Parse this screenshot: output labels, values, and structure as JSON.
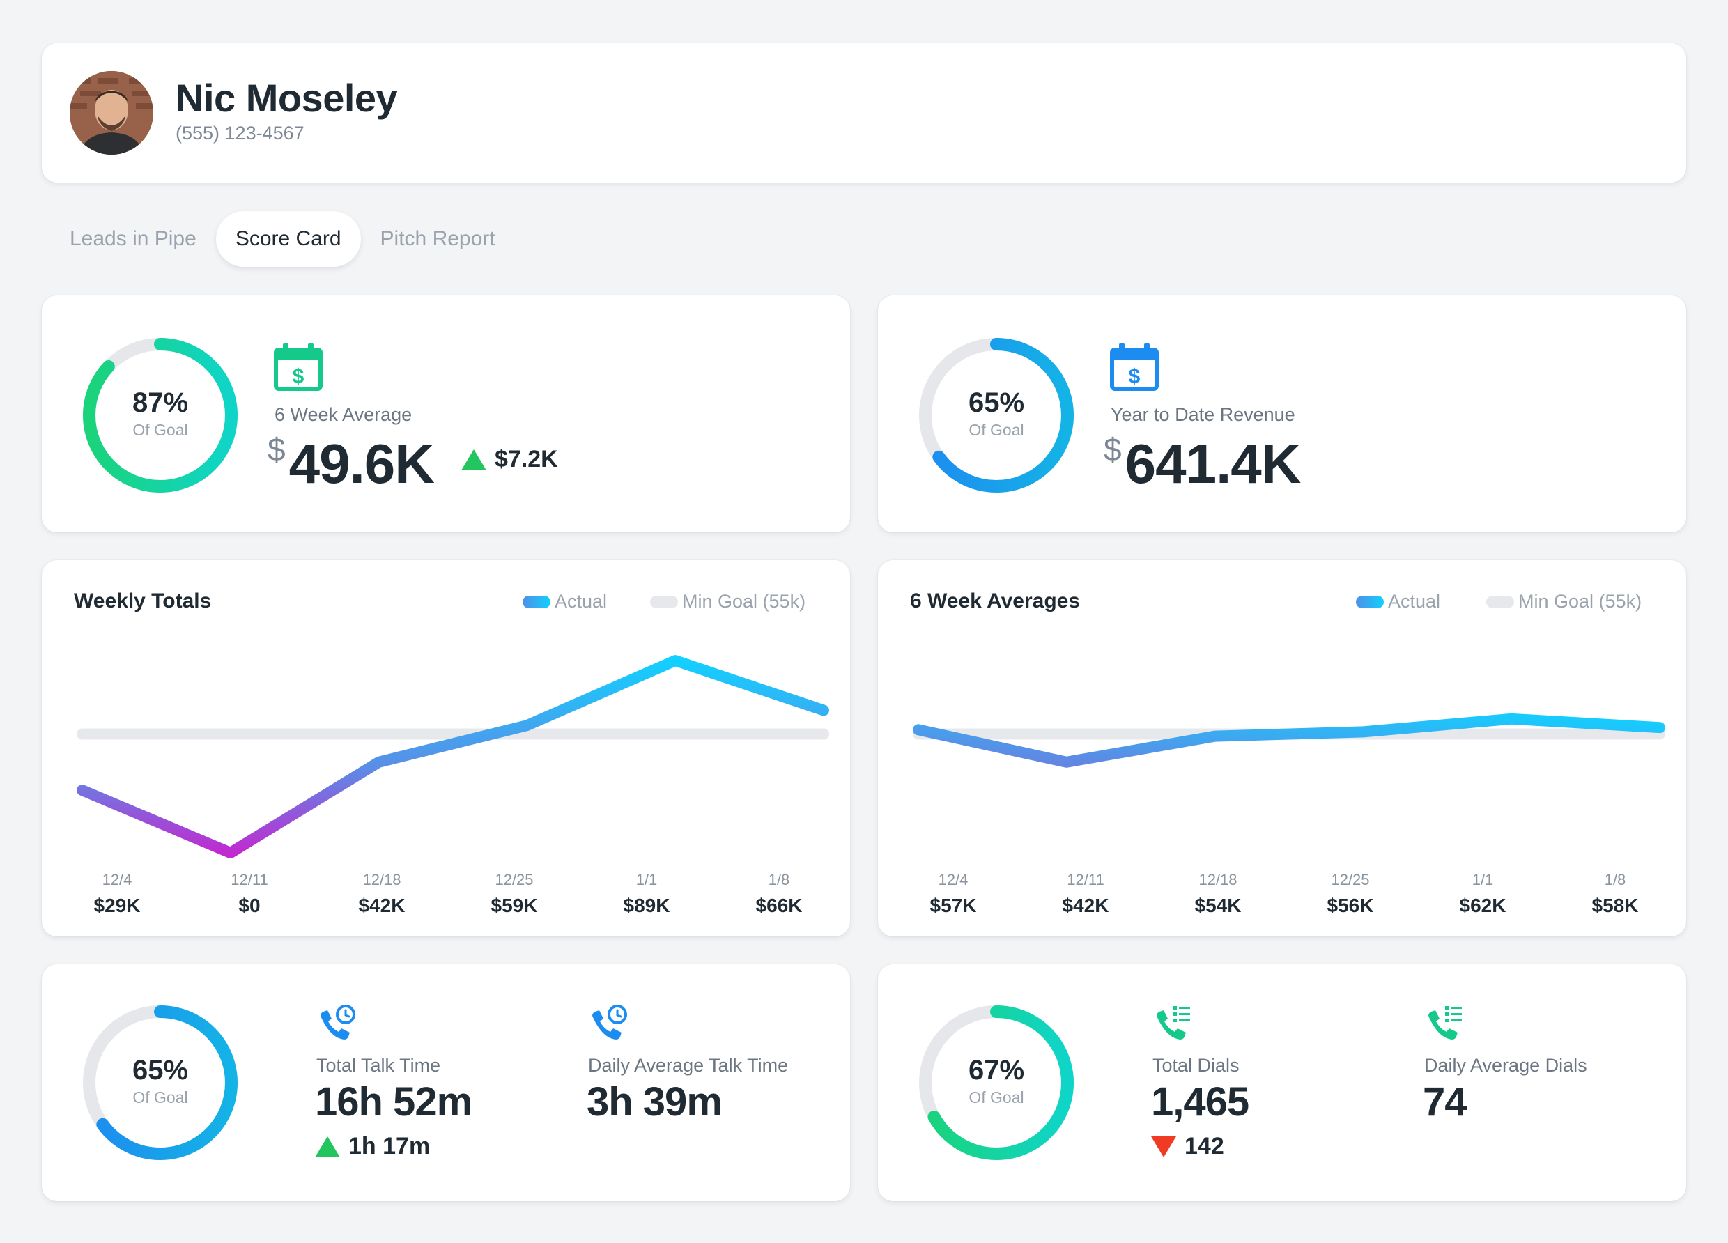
{
  "profile": {
    "name": "Nic Moseley",
    "phone": "(555) 123-4567"
  },
  "tabs": [
    {
      "label": "Leads in Pipe",
      "active": false
    },
    {
      "label": "Score Card",
      "active": true
    },
    {
      "label": "Pitch Report",
      "active": false
    }
  ],
  "kpis": {
    "left": {
      "ring_percent": "87%",
      "ring_fraction": 0.87,
      "ring_sub": "Of Goal",
      "icon": "calendar-dollar-icon",
      "label": "6 Week Average",
      "currency": "$",
      "value": "49.6K",
      "delta": "$7.2K",
      "delta_direction": "up"
    },
    "right": {
      "ring_percent": "65%",
      "ring_fraction": 0.65,
      "ring_sub": "Of Goal",
      "icon": "calendar-dollar-icon",
      "label": "Year to Date Revenue",
      "currency": "$",
      "value": "641.4K"
    }
  },
  "legend": {
    "actual": "Actual",
    "goal": "Min Goal (55k)"
  },
  "chart_data": [
    {
      "type": "line",
      "title": "Weekly Totals",
      "x": [
        "12/4",
        "12/11",
        "12/18",
        "12/25",
        "1/1",
        "1/8"
      ],
      "value_labels": [
        "$29K",
        "$0",
        "$42K",
        "$59K",
        "$89K",
        "$66K"
      ],
      "series": [
        {
          "name": "Actual",
          "values": [
            29,
            0,
            42,
            59,
            89,
            66
          ]
        },
        {
          "name": "Min Goal (55k)",
          "values": [
            55,
            55,
            55,
            55,
            55,
            55
          ]
        }
      ],
      "ylim": [
        0,
        100
      ]
    },
    {
      "type": "line",
      "title": "6 Week Averages",
      "x": [
        "12/4",
        "12/11",
        "12/18",
        "12/25",
        "1/1",
        "1/8"
      ],
      "value_labels": [
        "$57K",
        "$42K",
        "$54K",
        "$56K",
        "$62K",
        "$58K"
      ],
      "series": [
        {
          "name": "Actual",
          "values": [
            57,
            42,
            54,
            56,
            62,
            58
          ]
        },
        {
          "name": "Min Goal (55k)",
          "values": [
            55,
            55,
            55,
            55,
            55,
            55
          ]
        }
      ],
      "ylim": [
        0,
        100
      ]
    }
  ],
  "talk": {
    "ring_percent": "65%",
    "ring_fraction": 0.65,
    "ring_sub": "Of Goal",
    "total_label": "Total Talk Time",
    "total_value": "16h 52m",
    "total_delta": "1h 17m",
    "total_delta_direction": "up",
    "daily_label": "Daily Average Talk Time",
    "daily_value": "3h 39m"
  },
  "dials": {
    "ring_percent": "67%",
    "ring_fraction": 0.67,
    "ring_sub": "Of Goal",
    "total_label": "Total Dials",
    "total_value": "1,465",
    "total_delta": "142",
    "total_delta_direction": "down",
    "daily_label": "Daily Average Dials",
    "daily_value": "74"
  },
  "colors": {
    "green_start": "#1ad37a",
    "green_end": "#0fd5c9",
    "blue_start": "#1d8cf0",
    "blue_end": "#14b3e6",
    "line_high": "#12d0ff",
    "line_mid": "#4f8fe6",
    "line_low": "#c02ad0",
    "goal_line": "#e6e8eb",
    "ring_track": "#e5e7ea",
    "up": "#22c55e",
    "down": "#ef3b24"
  }
}
